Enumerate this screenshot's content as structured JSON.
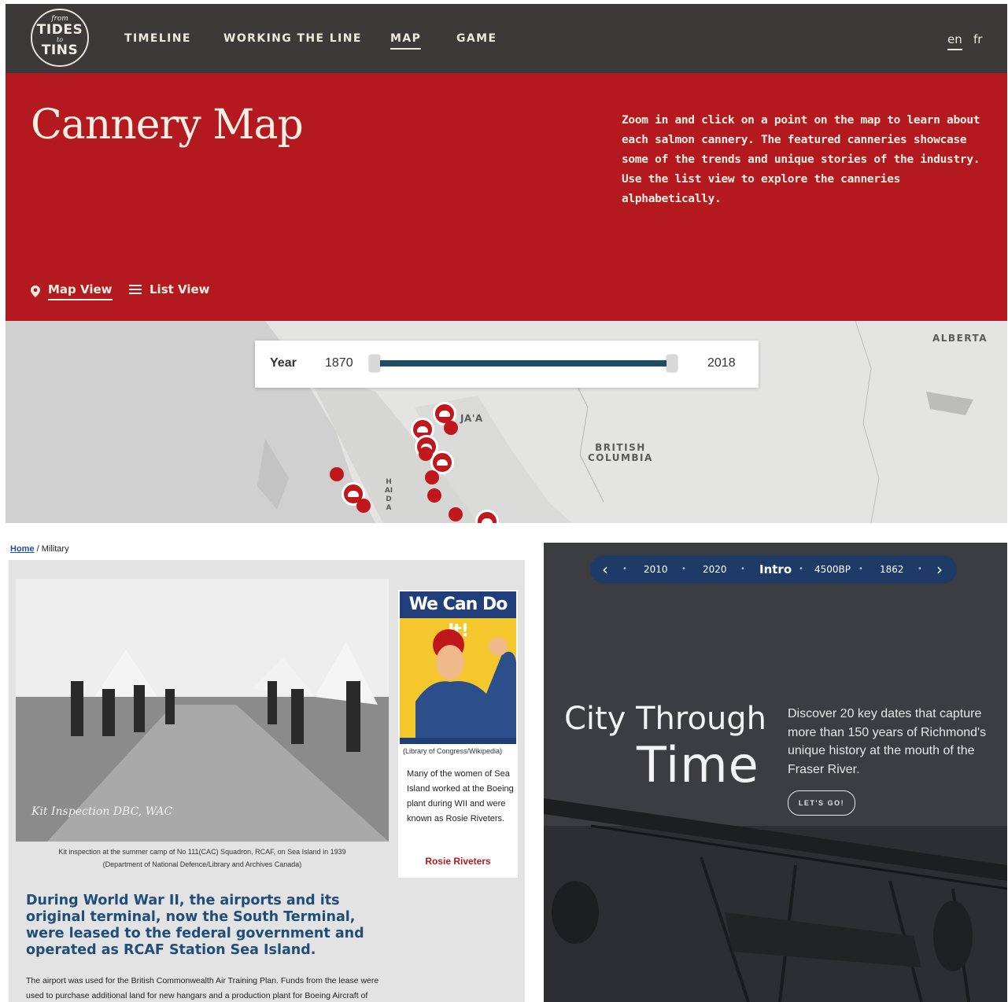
{
  "tides": {
    "logo": {
      "small": "from",
      "line1": "TIDES",
      "to": "to",
      "line2": "TINS"
    },
    "nav": [
      "TIMELINE",
      "WORKING THE LINE",
      "MAP",
      "GAME"
    ],
    "active_nav": "MAP",
    "langs": [
      "en",
      "fr"
    ],
    "title": "Cannery Map",
    "intro": "Zoom in and click on a point on the map to learn about each salmon cannery. The featured canneries showcase some of the trends and unique stories of the industry. Use the list view to explore the canneries alphabetically.",
    "views": {
      "map": "Map View",
      "list": "List View"
    },
    "slider": {
      "label": "Year",
      "start": "1870",
      "end": "2018"
    },
    "map_labels": {
      "alberta": "ALBERTA",
      "bc_line1": "BRITISH",
      "bc_line2": "COLUMBIA",
      "haida": "HAIDA",
      "coast": "JA'A"
    },
    "colors": {
      "nav_bg": "#3c3a38",
      "hero_red": "#b3191e",
      "marker_red": "#c0171c",
      "slider_blue": "#1f4e64"
    }
  },
  "military": {
    "breadcrumb_home": "Home",
    "breadcrumb_sep": "/",
    "breadcrumb_current": "Military",
    "photo_handwriting": "Kit Inspection DBC, WAC",
    "photo_caption_line1": "Kit inspection at the summer camp of No 111(CAC) Squadron, RCAF, on Sea Island in 1939",
    "photo_caption_line2": "(Department of National Defence/Library and Archives Canada)",
    "poster_title": "We Can Do It!",
    "poster_credit": "(Library of Congress/Wikipedia)",
    "poster_text": "Many of the women of Sea Island worked at the Boeing plant during WII and were known as Rosie Riveters.",
    "poster_link": "Rosie Riveters",
    "heading": "During World War II, the airports and its original terminal, now the South Terminal, were leased to the federal government and operated as RCAF Station Sea Island.",
    "body": "The airport was used for the British Commonwealth Air Training Plan. Funds from the lease were used to purchase additional land for new hangars and a production plant for Boeing Aircraft of Canada."
  },
  "city": {
    "timeline": [
      "2010",
      "2020",
      "Intro",
      "4500BP",
      "1862"
    ],
    "active": "Intro",
    "title_line1": "City Through",
    "title_line2": "Time",
    "description": "Discover 20 key dates that capture more than 150 years of Richmond's unique history at the mouth of the Fraser River.",
    "cta": "LET'S GO!",
    "colors": {
      "bg": "#3b3d40",
      "nav_bg": "#1e3a67"
    }
  }
}
